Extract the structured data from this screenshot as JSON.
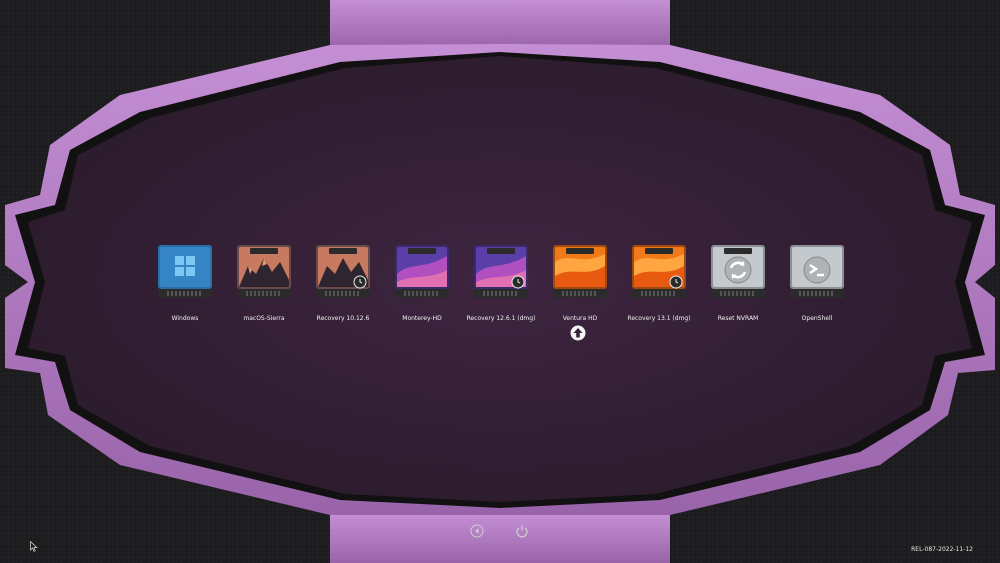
{
  "theme": {
    "frame_color": "#b07bc0",
    "frame_shadow": "#6e3f7f",
    "inner_bg": "#3a2238",
    "label_color": "#f2f2f2"
  },
  "boot_entries": [
    {
      "label": "Windows",
      "icon": "windows-drive-icon",
      "badge": null
    },
    {
      "label": "macOS-Sierra",
      "icon": "macos-sierra-drive-icon",
      "badge": null
    },
    {
      "label": "Recovery 10.12.6",
      "icon": "macos-sierra-drive-icon",
      "badge": "recovery-badge-icon"
    },
    {
      "label": "Monterey-HD",
      "icon": "macos-monterey-drive-icon",
      "badge": null
    },
    {
      "label": "Recovery 12.6.1 (dmg)",
      "icon": "macos-monterey-drive-icon",
      "badge": "recovery-badge-icon"
    },
    {
      "label": "Ventura HD",
      "icon": "macos-ventura-drive-icon",
      "badge": null
    },
    {
      "label": "Recovery 13.1 (dmg)",
      "icon": "macos-ventura-drive-icon",
      "badge": "recovery-badge-icon"
    },
    {
      "label": "Reset NVRAM",
      "icon": "reset-nvram-drive-icon",
      "badge": null
    },
    {
      "label": "OpenShell",
      "icon": "openshell-drive-icon",
      "badge": null
    }
  ],
  "selected_index": 5,
  "selection_indicator": "selected-arrow-up-icon",
  "tools": [
    {
      "name": "restart-icon"
    },
    {
      "name": "shutdown-icon"
    }
  ],
  "footer": {
    "version": "REL-087-2022-11-12"
  }
}
